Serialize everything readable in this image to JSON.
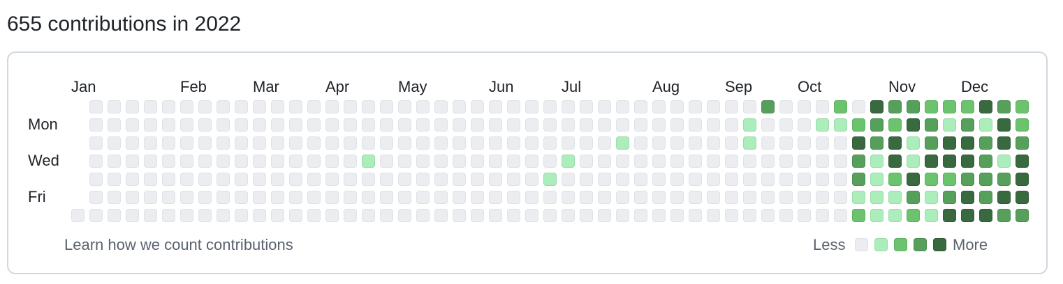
{
  "header": {
    "title": "655 contributions in 2022"
  },
  "calendar": {
    "months": [
      "Jan",
      "Feb",
      "Mar",
      "Apr",
      "May",
      "Jun",
      "Jul",
      "Aug",
      "Sep",
      "Oct",
      "Nov",
      "Dec"
    ],
    "weekday_labels": [
      "Mon",
      "Wed",
      "Fri"
    ],
    "level_colors": [
      "#ebedf0",
      "#aceebb",
      "#6bc46d",
      "#56a05c",
      "#39693f"
    ],
    "first_week_starts_on_row": 6,
    "levels_by_day_row": [
      "_0000000000000000000000000000000000000300020433222432",
      "_0000000000000000000000000000000000001000112324313142",
      "_0000000000000000000000000000010000001000004341344343",
      "_0000000000000001000000000010000000000000003141444314",
      "_0000000000000000000000000100000000000000003124223334",
      "_0000000000000000000000000000000000000000001113134344",
      "00000000000000000000000000000000000000000002112144433"
    ]
  },
  "footer": {
    "learn_link": "Learn how we count contributions",
    "legend_less": "Less",
    "legend_more": "More"
  }
}
